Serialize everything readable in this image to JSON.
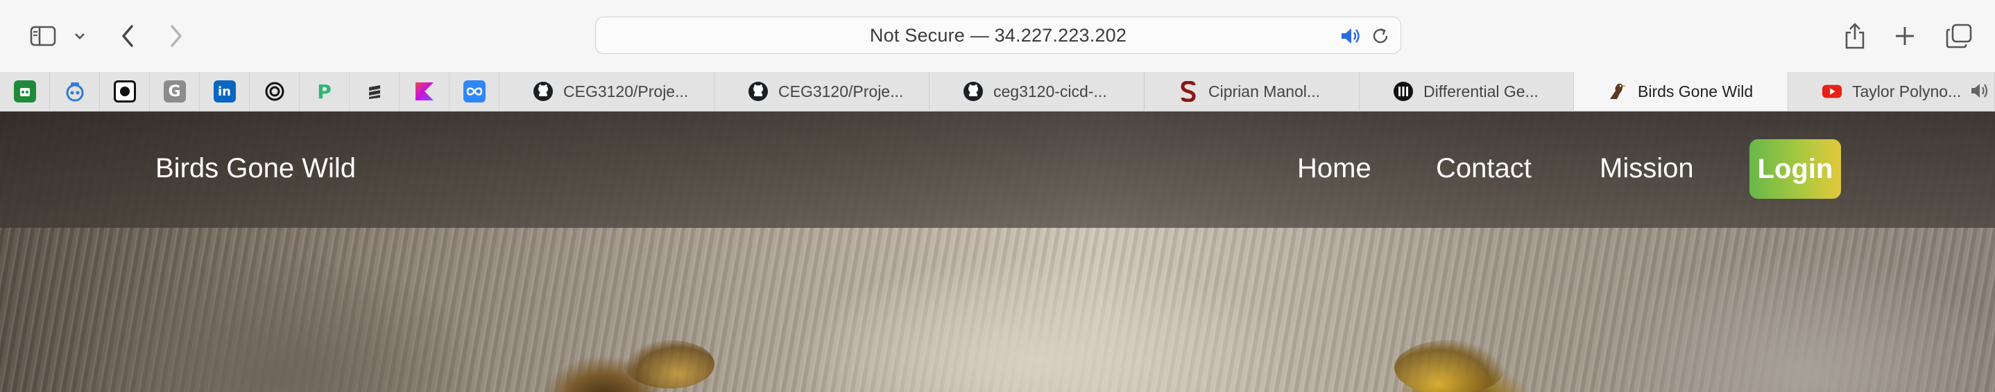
{
  "browser": {
    "address_text": "Not Secure — 34.227.223.202",
    "icons": [
      "sidebar-icon",
      "chevron-down-icon",
      "back-arrow-icon",
      "forward-arrow-icon",
      "speaker-icon",
      "reload-icon",
      "share-icon",
      "plus-icon",
      "tabs-overview-icon"
    ]
  },
  "pinned_tabs": [
    {
      "icon": "green-app-icon",
      "color": "#1f8a3a"
    },
    {
      "icon": "blue-robot-icon",
      "color": "#2f7bd8"
    },
    {
      "icon": "black-circle-icon",
      "color": "#111111"
    },
    {
      "icon": "g-icon",
      "color": "#8c8c8c",
      "glyph": "G"
    },
    {
      "icon": "linkedin-icon",
      "color": "#0a66c2",
      "glyph": "in"
    },
    {
      "icon": "openai-icon",
      "color": "#111111"
    },
    {
      "icon": "p-icon",
      "color": "#2bb673",
      "glyph": "P"
    },
    {
      "icon": "stack-icon",
      "color": "#333333"
    },
    {
      "icon": "kotlin-icon",
      "color": "#7f52ff"
    },
    {
      "icon": "infinity-icon",
      "color": "#2f86f7"
    }
  ],
  "tabs": [
    {
      "label": "CEG3120/Proje...",
      "icon": "github-icon"
    },
    {
      "label": "CEG3120/Proje...",
      "icon": "github-icon"
    },
    {
      "label": "ceg3120-cicd-...",
      "icon": "github-icon"
    },
    {
      "label": "Ciprian Manol...",
      "icon": "stanford-icon"
    },
    {
      "label": "Differential Ge...",
      "icon": "film-icon"
    },
    {
      "label": "Birds Gone Wild",
      "icon": "eagle-icon"
    },
    {
      "label": "Taylor Polyno...",
      "icon": "youtube-icon"
    }
  ],
  "site": {
    "brand": "Birds Gone Wild",
    "nav": {
      "home": "Home",
      "contact": "Contact",
      "mission": "Mission",
      "login": "Login"
    },
    "login_gradient": [
      "#68b84a",
      "#e3c83c"
    ]
  }
}
